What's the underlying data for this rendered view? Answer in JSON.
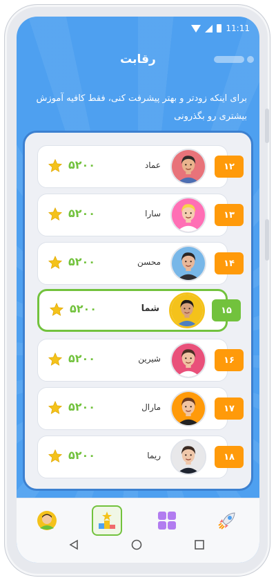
{
  "status_bar": {
    "time": "11:11",
    "icons": [
      "wifi-icon",
      "signal-icon",
      "battery-icon"
    ]
  },
  "header": {
    "title": "رقابت"
  },
  "intro": {
    "text": "برای اینکه زودتر و بهتر پیشرفت کنی، فقط کافیه آموزش بیشتری رو بگذرونی"
  },
  "leaderboard": {
    "rows": [
      {
        "rank": "۱۲",
        "name": "عماد",
        "score": "۵۲۰۰",
        "avatar": "man-cap",
        "current": false
      },
      {
        "rank": "۱۳",
        "name": "سارا",
        "score": "۵۲۰۰",
        "avatar": "girl-blonde",
        "current": false
      },
      {
        "rank": "۱۴",
        "name": "محسن",
        "score": "۵۲۰۰",
        "avatar": "man-smile",
        "current": false
      },
      {
        "rank": "۱۵",
        "name": "شما",
        "score": "۵۲۰۰",
        "avatar": "man-stubble",
        "current": true
      },
      {
        "rank": "۱۶",
        "name": "شیرین",
        "score": "۵۲۰۰",
        "avatar": "woman-laugh",
        "current": false
      },
      {
        "rank": "۱۷",
        "name": "مارال",
        "score": "۵۲۰۰",
        "avatar": "woman-curly",
        "current": false
      },
      {
        "rank": "۱۸",
        "name": "ریما",
        "score": "۵۲۰۰",
        "avatar": "woman-office",
        "current": false
      }
    ]
  },
  "bottom_nav": {
    "items": [
      {
        "icon": "profile-icon",
        "active": false
      },
      {
        "icon": "podium-icon",
        "active": true
      },
      {
        "icon": "apps-grid-icon",
        "active": false
      },
      {
        "icon": "rocket-icon",
        "active": false
      }
    ]
  },
  "system_nav": {
    "icons": [
      "back-icon",
      "home-icon",
      "recents-icon"
    ]
  },
  "colors": {
    "background_blue": "#4ea0f0",
    "board_border": "#3c80d0",
    "rank_orange": "#ff9a0a",
    "highlight_green": "#72c23d",
    "star_yellow": "#f4c21b"
  }
}
